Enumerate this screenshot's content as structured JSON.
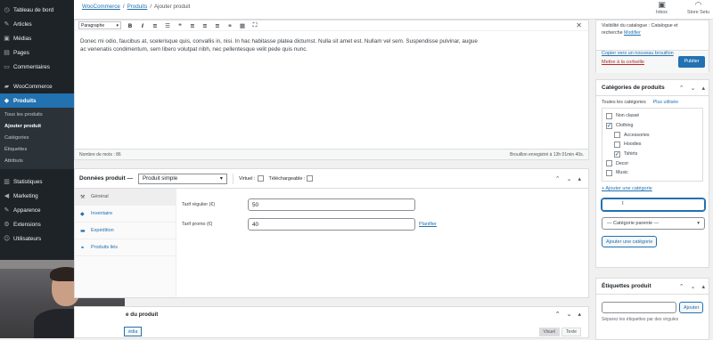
{
  "sidebar": {
    "items": [
      {
        "label": "Tableau de bord",
        "icon": "dashboard-icon",
        "glyph": "◷"
      },
      {
        "label": "Articles",
        "icon": "pin-icon",
        "glyph": "✎"
      },
      {
        "label": "Médias",
        "icon": "media-icon",
        "glyph": "▣"
      },
      {
        "label": "Pages",
        "icon": "page-icon",
        "glyph": "▤"
      },
      {
        "label": "Commentaires",
        "icon": "comment-icon",
        "glyph": "▭"
      }
    ],
    "items2": [
      {
        "label": "WooCommerce",
        "icon": "woocommerce-icon",
        "glyph": "▰"
      },
      {
        "label": "Produits",
        "icon": "products-icon",
        "glyph": "◆"
      }
    ],
    "submenu": [
      "Tous les produits",
      "Ajouter produit",
      "Catégories",
      "Étiquettes",
      "Attributs"
    ],
    "items3": [
      {
        "label": "Statistiques",
        "icon": "stats-icon",
        "glyph": "▥"
      },
      {
        "label": "Marketing",
        "icon": "megaphone-icon",
        "glyph": "◀"
      },
      {
        "label": "Apparence",
        "icon": "brush-icon",
        "glyph": "✎"
      },
      {
        "label": "Extensions",
        "icon": "plugin-icon",
        "glyph": "⚙"
      },
      {
        "label": "Utilisateurs",
        "icon": "users-icon",
        "glyph": "☺"
      }
    ]
  },
  "topbar": {
    "breadcrumb": [
      "WooCommerce",
      "Produits",
      "Ajouter produit"
    ],
    "separator": "/",
    "inbox": "Inbox",
    "store_setup": "Store Setu"
  },
  "editor": {
    "format": "Paragraphe",
    "body": "Donec mi odio, faucibus at, scelerisque quis, convallis in, nisi. In hac habitasse platea dictumst. Nulla sit amet est. Nullam vel sem. Suspendisse pulvinar, augue ac venenatis condimentum, sem libero volutpat nibh, nec pellentesque velit pede quis nunc.",
    "word_count": "Nombre de mots : 86",
    "draft_saved": "Brouillon enregistré à 13h 01min 40s."
  },
  "product_data": {
    "title": "Données produit —",
    "type": "Produit simple",
    "virtual": "Virtuel :",
    "downloadable": "Téléchargeable :",
    "tabs": [
      {
        "label": "Général",
        "icon": "wrench-icon",
        "glyph": "⚒"
      },
      {
        "label": "Inventaire",
        "icon": "inventory-icon",
        "glyph": "◆"
      },
      {
        "label": "Expédition",
        "icon": "truck-icon",
        "glyph": "▬"
      },
      {
        "label": "Produits liés",
        "icon": "link-icon",
        "glyph": "⚭"
      }
    ],
    "regular_price_label": "Tarif régulier (€)",
    "regular_price": "50",
    "sale_price_label": "Tarif promo (€)",
    "sale_price": "40",
    "schedule": "Planifier"
  },
  "short_description": {
    "title": "e du produit",
    "add_media": "édia",
    "tab_visual": "Visuel",
    "tab_text": "Texte"
  },
  "publish": {
    "visibility_line1": "Visibilité du catalogue : Catalogue et",
    "visibility_line2": "recherche",
    "modify": "Modifier",
    "copy_draft": "Copier vers un nouveau brouillon",
    "trash": "Mettre à la corbeille",
    "publish_button": "Publier"
  },
  "categories": {
    "title": "Catégories de produits",
    "tab_all": "Toutes les catégories",
    "tab_popular": "Plus utilisée",
    "items": [
      {
        "label": "Non classé",
        "checked": false,
        "child": false
      },
      {
        "label": "Clothing",
        "checked": true,
        "child": false
      },
      {
        "label": "Accessories",
        "checked": false,
        "child": true
      },
      {
        "label": "Hoodies",
        "checked": false,
        "child": true
      },
      {
        "label": "Tshirts",
        "checked": true,
        "child": true
      },
      {
        "label": "Decor",
        "checked": false,
        "child": false
      },
      {
        "label": "Music",
        "checked": false,
        "child": false
      }
    ],
    "add_link": "+ Ajouter une catégorie",
    "parent_select": "— Catégorie parente —",
    "add_button": "Ajouter une catégorie"
  },
  "tags": {
    "title": "Étiquettes produit",
    "add_button": "Ajouter",
    "hint": "Séparez les étiquettes par des virgules"
  },
  "colors": {
    "admin_bar": "#1d2327",
    "accent": "#2271b1",
    "trash": "#b32d2e"
  }
}
